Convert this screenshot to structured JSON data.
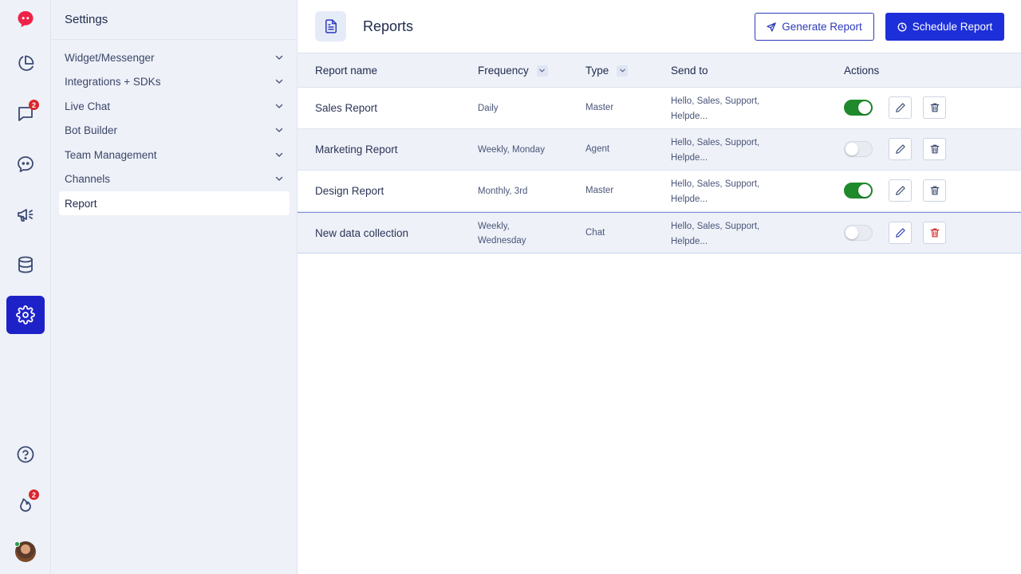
{
  "rail": {
    "chat_badge": "2",
    "notify_badge": "2"
  },
  "settings": {
    "title": "Settings",
    "items": [
      {
        "label": "Widget/Messenger"
      },
      {
        "label": "Integrations + SDKs"
      },
      {
        "label": "Live Chat"
      },
      {
        "label": "Bot Builder"
      },
      {
        "label": "Team Management"
      },
      {
        "label": "Channels"
      },
      {
        "label": "Report"
      }
    ]
  },
  "header": {
    "title": "Reports",
    "generate_label": "Generate Report",
    "schedule_label": "Schedule Report"
  },
  "table": {
    "columns": {
      "name": "Report name",
      "frequency": "Frequency",
      "type": "Type",
      "send_to": "Send to",
      "actions": "Actions"
    },
    "rows": [
      {
        "name": "Sales Report",
        "freq1": "Daily",
        "freq2": "",
        "type": "Master",
        "send1": "Hello, Sales, Support,",
        "send2": "Helpde...",
        "enabled": true
      },
      {
        "name": "Marketing Report",
        "freq1": "Weekly, Monday",
        "freq2": "",
        "type": "Agent",
        "send1": "Hello, Sales, Support,",
        "send2": "Helpde...",
        "enabled": false
      },
      {
        "name": "Design Report",
        "freq1": "Monthly, 3rd",
        "freq2": "",
        "type": "Master",
        "send1": "Hello, Sales, Support,",
        "send2": "Helpde...",
        "enabled": true
      },
      {
        "name": "New data collection",
        "freq1": "Weekly,",
        "freq2": "Wednesday",
        "type": "Chat",
        "send1": "Hello, Sales, Support,",
        "send2": "Helpde...",
        "enabled": false
      }
    ]
  },
  "colors": {
    "accent": "#1d2fd8",
    "toggle_on": "#1f8a2c",
    "danger": "#d42a2a",
    "badge": "#d8262c"
  }
}
